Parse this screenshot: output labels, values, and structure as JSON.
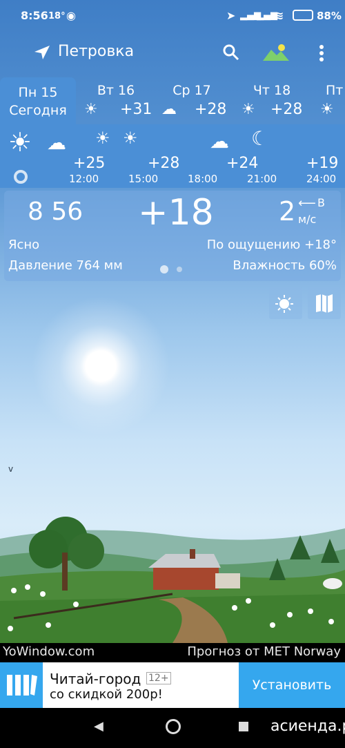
{
  "status_bar": {
    "time": "8:56",
    "temp": "18°",
    "battery": "88%"
  },
  "header": {
    "location": "Петровка"
  },
  "days": [
    {
      "name": "Пн 15",
      "sub": "Сегодня",
      "selected": true
    },
    {
      "name": "Вт 16",
      "temp": "+31",
      "icon": "sun-cloud-icon"
    },
    {
      "name": "Ср 17",
      "temp": "+28",
      "icon": "cloud-icon"
    },
    {
      "name": "Чт 18",
      "temp": "+28",
      "icon": "sun-icon"
    },
    {
      "name": "Пт",
      "icon": "sun-icon"
    }
  ],
  "hourly": [
    {
      "time": "12:00",
      "temp": "+25"
    },
    {
      "time": "15:00",
      "temp": "+28"
    },
    {
      "time": "18:00",
      "temp": "+24"
    },
    {
      "time": "21:00",
      "temp": "+19"
    },
    {
      "time": "24:00",
      "temp": ""
    }
  ],
  "current": {
    "time": "8 56",
    "temp": "+18",
    "wind_speed": "2",
    "wind_dir": "В",
    "wind_unit": "м/с",
    "condition": "Ясно",
    "feels_like": "По ощущению +18°",
    "pressure": "Давление 764 мм",
    "humidity": "Влажность 60%"
  },
  "footer": {
    "left": "YoWindow.com",
    "right": "Прогноз от MET Norway"
  },
  "ad": {
    "title": "Читай-город",
    "age": "12+",
    "subtitle": "со скидкой 200р!",
    "button": "Установить"
  },
  "watermark": "асиенда.ру",
  "colors": {
    "accent": "#4b8fd6",
    "ad_button": "#35a7ee"
  }
}
